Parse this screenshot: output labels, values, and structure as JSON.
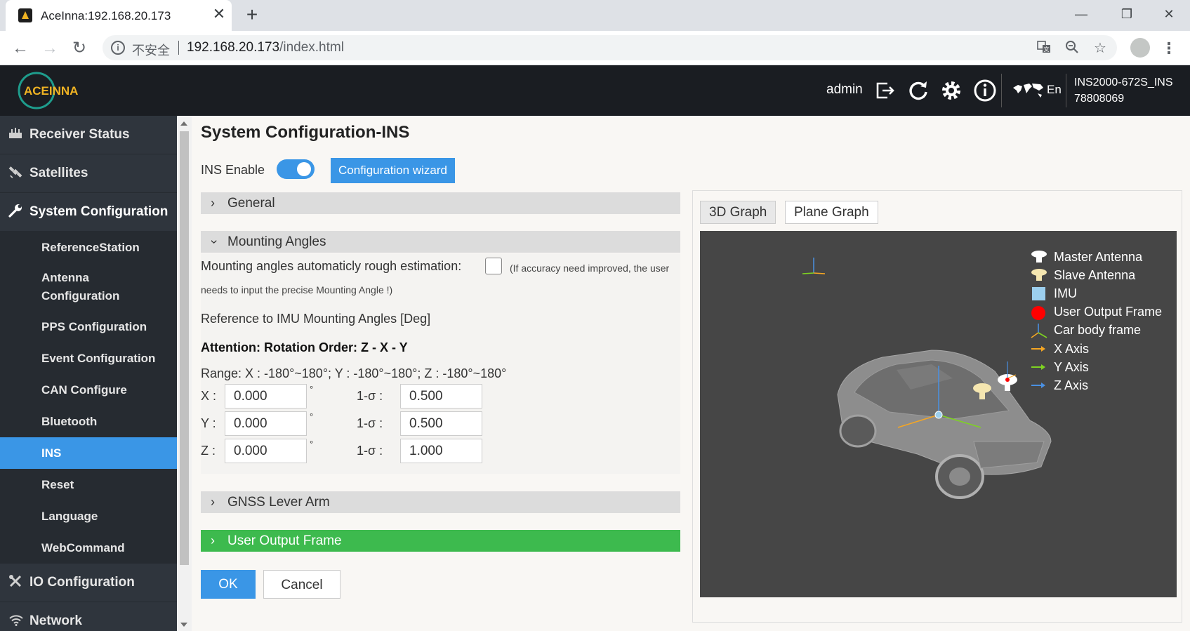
{
  "browser": {
    "tab_title": "AceInna:192.168.20.173",
    "tab_close": "✕",
    "new_tab": "+",
    "insecure_label": "不安全",
    "url_host": "192.168.20.173",
    "url_path": "/index.html",
    "window_minimize": "—",
    "window_maximize": "❐",
    "window_close": "✕"
  },
  "header": {
    "logo_text": "ACEINNA",
    "user": "admin",
    "language": "En",
    "device_model": "INS2000-672S_INS",
    "device_serial": "78808069"
  },
  "sidebar": {
    "receiver_status": "Receiver Status",
    "satellites": "Satellites",
    "system_configuration": "System Configuration",
    "sub_items": [
      "ReferenceStation",
      "Antenna Configuration",
      "PPS Configuration",
      "Event Configuration",
      "CAN Configure",
      "Bluetooth",
      "INS",
      "Reset",
      "Language",
      "WebCommand"
    ],
    "io_configuration": "IO Configuration",
    "network": "Network"
  },
  "main": {
    "title": "System Configuration-INS",
    "ins_enable_label": "INS Enable",
    "ins_enabled": true,
    "wizard_button": "Configuration wizard",
    "sections": {
      "general": "General",
      "mounting_angles": "Mounting Angles",
      "gnss_lever_arm": "GNSS Lever Arm",
      "user_output_frame": "User Output Frame"
    },
    "auto_estimation_label": "Mounting angles automaticly rough estimation:",
    "auto_estimation_note_1": "(If accuracy need improved, the user",
    "auto_estimation_note_2": "needs to input the precise Mounting Angle !)",
    "reference_label": "Reference to IMU Mounting Angles [Deg]",
    "attention": "Attention: Rotation Order: Z - X - Y",
    "range": "Range: X : -180°~180°; Y : -180°~180°; Z : -180°~180°",
    "degree_symbol": "°",
    "sigma_label": "1-σ :",
    "angles": [
      {
        "axis": "X :",
        "value": "0.000",
        "sigma": "0.500"
      },
      {
        "axis": "Y :",
        "value": "0.000",
        "sigma": "0.500"
      },
      {
        "axis": "Z :",
        "value": "0.000",
        "sigma": "1.000"
      }
    ],
    "ok_button": "OK",
    "cancel_button": "Cancel"
  },
  "graph": {
    "tabs": [
      "3D Graph",
      "Plane Graph"
    ],
    "active_tab": "3D Graph",
    "legend": [
      {
        "label": "Master Antenna",
        "color": "#ffffff"
      },
      {
        "label": "Slave Antenna",
        "color": "#f5e6b0"
      },
      {
        "label": "IMU",
        "color": "#9ccfee"
      },
      {
        "label": "User Output Frame",
        "color": "#ff0000"
      },
      {
        "label": "Car body frame",
        "color": "#4a90e2"
      },
      {
        "label": "X Axis",
        "color": "#f5a623"
      },
      {
        "label": "Y Axis",
        "color": "#7ed321"
      },
      {
        "label": "Z Axis",
        "color": "#4a90e2"
      }
    ]
  },
  "colors": {
    "accent": "#3a96e6",
    "sidebar_bg": "#2f353d",
    "header_bg": "#1a1d22",
    "success": "#3dba4e",
    "canvas_bg": "#464646"
  }
}
